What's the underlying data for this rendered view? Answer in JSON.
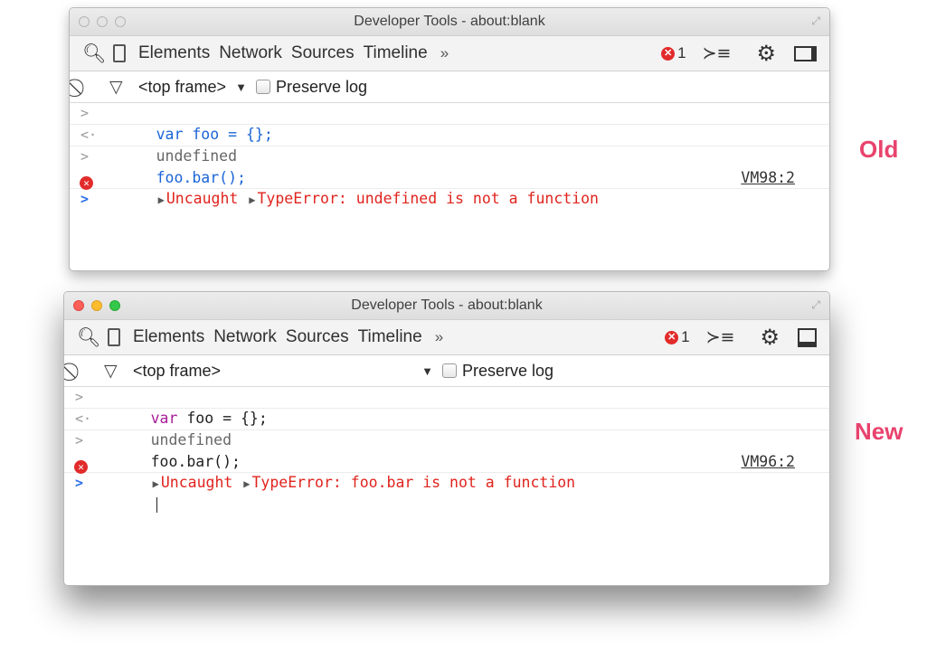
{
  "old": {
    "title": "Developer Tools - about:blank",
    "tabs": [
      "Elements",
      "Network",
      "Sources",
      "Timeline"
    ],
    "more": "»",
    "error_count": "1",
    "frame": "<top frame>",
    "preserve_log": "Preserve log",
    "lines": {
      "input1": "var foo = {};",
      "output1": "undefined",
      "input2": "foo.bar();",
      "err_uncaught": "Uncaught",
      "err_message": "TypeError: undefined is not a function",
      "err_source": "VM98:2"
    },
    "label": "Old"
  },
  "new": {
    "title": "Developer Tools - about:blank",
    "tabs": [
      "Elements",
      "Network",
      "Sources",
      "Timeline"
    ],
    "more": "»",
    "error_count": "1",
    "frame": "<top frame>",
    "preserve_log": "Preserve log",
    "lines": {
      "input1_keyword": "var",
      "input1_rest": " foo = {};",
      "output1": "undefined",
      "input2": "foo.bar();",
      "err_uncaught": "Uncaught",
      "err_message": "TypeError: foo.bar is not a function",
      "err_source": "VM96:2"
    },
    "label": "New"
  },
  "icons": {
    "search": "search-icon",
    "device": "device-mode-icon",
    "errors": "error-badge-icon",
    "drawer": "console-drawer-icon",
    "settings": "gear-icon",
    "dock": "dock-side-icon",
    "clear": "clear-console-icon",
    "filter": "filter-icon",
    "prompt": "prompt-chevron-icon"
  },
  "colors": {
    "error_red": "#e0241e",
    "label_pink": "#e8436d",
    "old_code_blue": "#1a64d6",
    "keyword_purple": "#a71d98"
  }
}
